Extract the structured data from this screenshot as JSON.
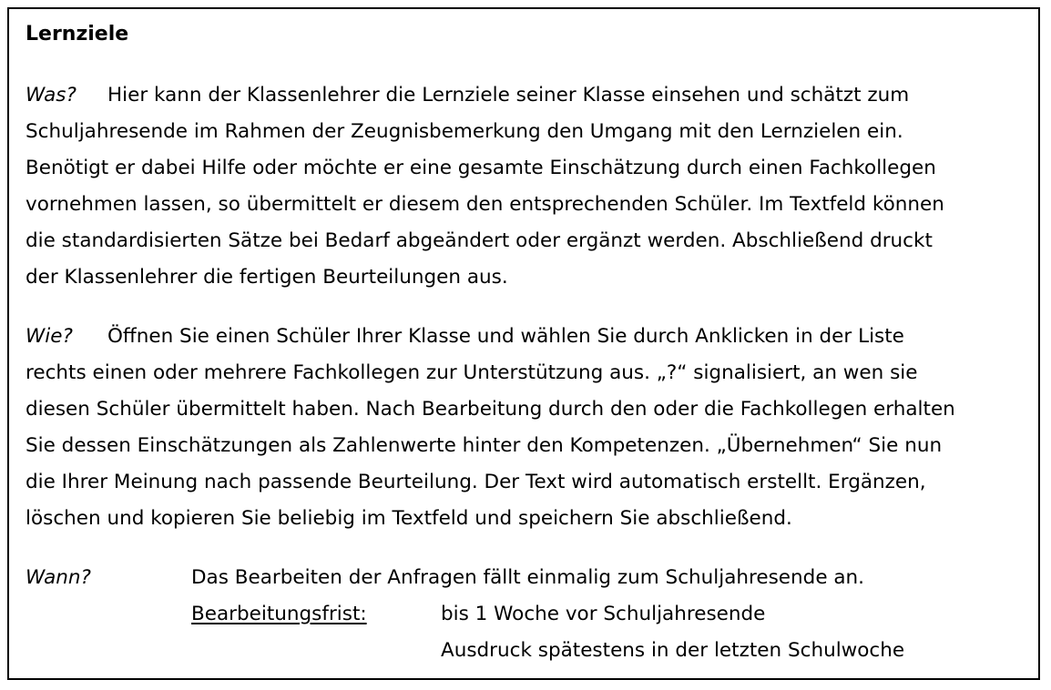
{
  "title": "Lernziele",
  "was": {
    "label": "Was?",
    "lines": [
      "Hier kann der Klassenlehrer die Lernziele seiner Klasse einsehen und schätzt zum",
      "Schuljahresende im Rahmen der Zeugnisbemerkung den Umgang mit den Lernzielen ein.",
      "Benötigt er dabei Hilfe oder möchte er eine gesamte Einschätzung durch einen Fachkollegen",
      "vornehmen lassen, so übermittelt er diesem den entsprechenden Schüler.  Im Textfeld können",
      "die standardisierten Sätze bei Bedarf abgeändert oder ergänzt werden. Abschließend druckt",
      "der Klassenlehrer die fertigen Beurteilungen aus."
    ]
  },
  "wie": {
    "label": "Wie?",
    "lines": [
      "Öffnen Sie einen Schüler Ihrer Klasse und wählen Sie durch Anklicken in der Liste",
      "rechts einen oder mehrere Fachkollegen zur Unterstützung aus. „?“ signalisiert, an wen sie",
      "diesen Schüler übermittelt haben. Nach Bearbeitung durch den oder die Fachkollegen erhalten",
      "Sie dessen Einschätzungen als Zahlenwerte hinter den Kompetenzen. „Übernehmen“ Sie nun",
      "die Ihrer Meinung nach passende Beurteilung. Der Text wird automatisch erstellt. Ergänzen,",
      "löschen und kopieren Sie beliebig im Textfeld und speichern Sie abschließend."
    ]
  },
  "wann": {
    "label": "Wann?",
    "text": "Das Bearbeiten der Anfragen fällt einmalig zum Schuljahresende an.",
    "frist_label": "Bearbeitungsfrist:",
    "frist_lines": [
      "bis 1 Woche vor Schuljahresende",
      "Ausdruck spätestens in der letzten Schulwoche"
    ]
  }
}
